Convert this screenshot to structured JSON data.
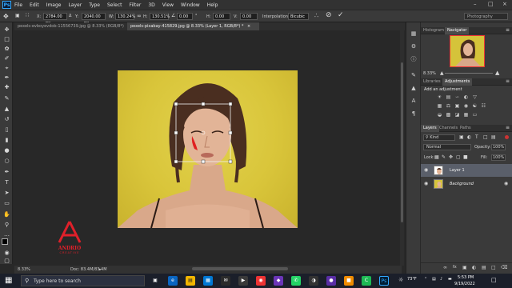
{
  "app": {
    "logo": "Ps",
    "menu": [
      "File",
      "Edit",
      "Image",
      "Layer",
      "Type",
      "Select",
      "Filter",
      "3D",
      "View",
      "Window",
      "Help"
    ]
  },
  "options": {
    "x_label": "X:",
    "x_value": "2784.00 px",
    "y_label": "Y:",
    "y_value": "2040.00 px",
    "w_label": "W:",
    "w_value": "130.24%",
    "h_label": "H:",
    "h_value": "130.51%",
    "angle_value": "0.00",
    "hskew_label": "H:",
    "hskew_value": "0.00",
    "vskew_label": "V:",
    "vskew_value": "0.00",
    "interp_label": "Interpolation:",
    "interp_value": "Bicubic",
    "workspace": "Photography"
  },
  "doc_tabs": [
    {
      "label": "pexels-evboyevdob-11556739.jpg @ 8.33% (RGB/8*)",
      "close": "×"
    },
    {
      "label": "pexels-pixabay-415829.jpg @ 8.33% (Layer 1, RGB/8*) *",
      "close": "×"
    }
  ],
  "status": {
    "zoom": "8.33%",
    "doc": "Doc: 83.4M/83.4M"
  },
  "watermark": {
    "line1": "ANDRIO",
    "line2": "CREATIVE"
  },
  "panels": {
    "histogram_tab": "Histogram",
    "navigator_tab": "Navigator",
    "nav_zoom": "8.33%",
    "libraries_tab": "Libraries",
    "adjustments_tab": "Adjustments",
    "add_adjustment": "Add an adjustment",
    "layers_tab": "Layers",
    "channels_tab": "Channels",
    "paths_tab": "Paths",
    "kind_label": "Kind",
    "blend_mode": "Normal",
    "opacity_label": "Opacity:",
    "opacity_value": "100%",
    "lock_label": "Lock:",
    "fill_label": "Fill:",
    "fill_value": "100%",
    "layers": [
      {
        "name": "Layer 1",
        "selected": true
      },
      {
        "name": "Background",
        "selected": false,
        "locked": true
      }
    ],
    "bottom_icons": [
      "link-icon",
      "fx-icon",
      "mask-icon",
      "adjustment-icon",
      "folder-icon",
      "new-layer-icon",
      "trash-icon"
    ]
  },
  "taskbar": {
    "search_placeholder": "Type here to search",
    "weather": "73°F",
    "time": "5:53 PM",
    "date": "9/19/2022"
  },
  "colors": {
    "accent": "#31a8ff",
    "canvas_bg": "#282828",
    "photo_bg": "#d9c53a",
    "watermark": "#e0202a"
  }
}
